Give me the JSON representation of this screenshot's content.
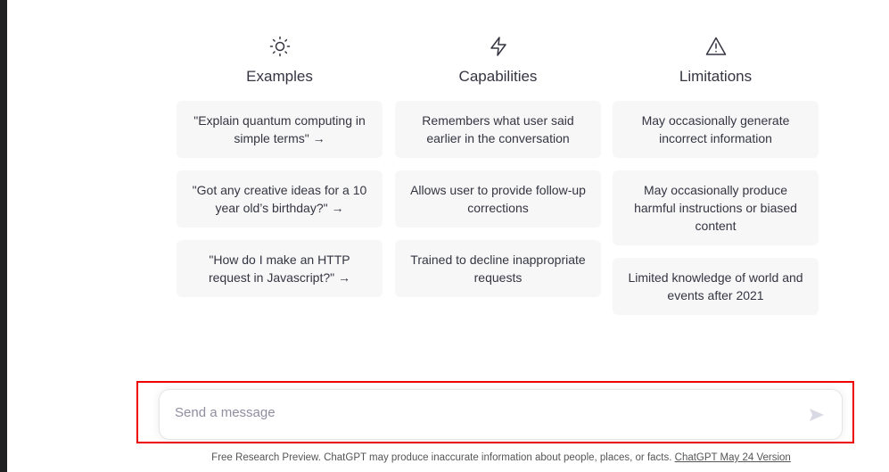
{
  "columns": [
    {
      "icon": "sun-icon",
      "title": "Examples",
      "items": [
        "\"Explain quantum computing in simple terms\" →",
        "\"Got any creative ideas for a 10 year old’s birthday?\" →",
        "\"How do I make an HTTP request in Javascript?\" →"
      ]
    },
    {
      "icon": "lightning-icon",
      "title": "Capabilities",
      "items": [
        "Remembers what user said earlier in the conversation",
        "Allows user to provide follow-up corrections",
        "Trained to decline inappropriate requests"
      ]
    },
    {
      "icon": "warning-icon",
      "title": "Limitations",
      "items": [
        "May occasionally generate incorrect information",
        "May occasionally produce harmful instructions or biased content",
        "Limited knowledge of world and events after 2021"
      ]
    }
  ],
  "composer": {
    "placeholder": "Send a message",
    "value": "",
    "send_icon": "send-icon"
  },
  "footer": {
    "text": "Free Research Preview. ChatGPT may produce inaccurate information about people, places, or facts. ",
    "link": "ChatGPT May 24 Version"
  },
  "colors": {
    "card_bg": "#f7f7f8",
    "highlight": "#e00000",
    "sidebar": "#202123"
  }
}
